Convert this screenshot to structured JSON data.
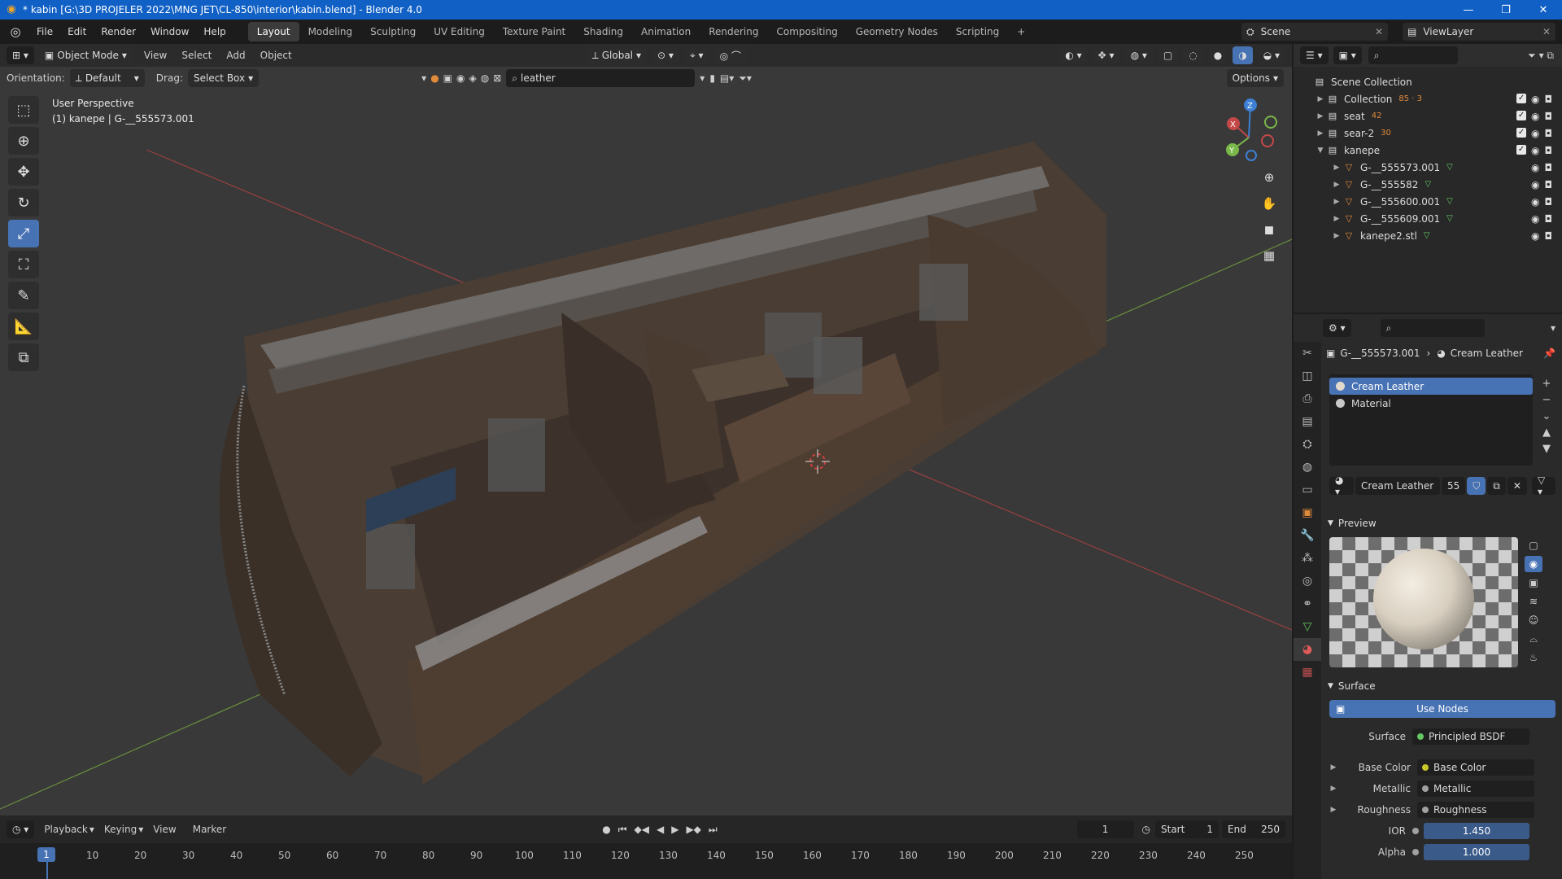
{
  "window": {
    "title": "* kabin [G:\\3D PROJELER 2022\\MNG JET\\CL-850\\interior\\kabin.blend] - Blender 4.0",
    "controls": [
      "—",
      "❐",
      "✕"
    ]
  },
  "menu": {
    "items": [
      "File",
      "Edit",
      "Render",
      "Window",
      "Help"
    ],
    "workspaces": [
      "Layout",
      "Modeling",
      "Sculpting",
      "UV Editing",
      "Texture Paint",
      "Shading",
      "Animation",
      "Rendering",
      "Compositing",
      "Geometry Nodes",
      "Scripting",
      "+"
    ],
    "active_workspace": "Layout",
    "scene": "Scene",
    "view_layer": "ViewLayer"
  },
  "viewport": {
    "mode": "Object Mode",
    "header_menus": [
      "View",
      "Select",
      "Add",
      "Object"
    ],
    "transform": "Global",
    "orientation_label": "Orientation:",
    "orientation_value": "Default",
    "drag_label": "Drag:",
    "drag_value": "Select Box",
    "search_value": "leather",
    "options_label": "Options",
    "info_line1": "User Perspective",
    "info_line2": "(1) kanepe | G-__555573.001",
    "gizmo_axes": {
      "z": "Z",
      "x": "X",
      "y": "Y"
    },
    "colors": {
      "x_axis": "#c44848",
      "y_axis": "#7ab84a",
      "z_axis": "#3d7fd4",
      "active_tool": "#4772b3"
    }
  },
  "timeline": {
    "menus": [
      "Playback",
      "Keying",
      "View",
      "Marker"
    ],
    "current_frame": "1",
    "start_label": "Start",
    "start_value": "1",
    "end_label": "End",
    "end_value": "250",
    "ruler": [
      "1",
      "10",
      "20",
      "30",
      "40",
      "50",
      "60",
      "70",
      "80",
      "90",
      "100",
      "110",
      "120",
      "130",
      "140",
      "150",
      "160",
      "170",
      "180",
      "190",
      "200",
      "210",
      "220",
      "230",
      "240",
      "250"
    ]
  },
  "outliner": {
    "root": "Scene Collection",
    "rows": [
      {
        "name": "Collection",
        "badge": "85 · 3",
        "type": "collection"
      },
      {
        "name": "seat",
        "badge": "42",
        "type": "collection"
      },
      {
        "name": "sear-2",
        "badge": "30",
        "type": "collection"
      },
      {
        "name": "kanepe",
        "badge": "",
        "type": "collection"
      },
      {
        "name": "G-__555573.001",
        "badge": "",
        "type": "mesh"
      },
      {
        "name": "G-__555582",
        "badge": "",
        "type": "mesh"
      },
      {
        "name": "G-__555600.001",
        "badge": "",
        "type": "mesh"
      },
      {
        "name": "G-__555609.001",
        "badge": "",
        "type": "mesh"
      },
      {
        "name": "kanepe2.stl",
        "badge": "",
        "type": "mesh"
      }
    ]
  },
  "properties": {
    "breadcrumb_object": "G-__555573.001",
    "breadcrumb_material": "Cream Leather",
    "slots": [
      "Cream Leather",
      "Material"
    ],
    "material_name": "Cream Leather",
    "material_users": "55",
    "preview_label": "Preview",
    "surface_label": "Surface",
    "use_nodes_label": "Use Nodes",
    "fields": [
      {
        "label": "Surface",
        "value": "Principled BSDF",
        "kind": "node"
      },
      {
        "label": "Base Color",
        "value": "Base Color",
        "kind": "link"
      },
      {
        "label": "Metallic",
        "value": "Metallic",
        "kind": "link"
      },
      {
        "label": "Roughness",
        "value": "Roughness",
        "kind": "link"
      },
      {
        "label": "IOR",
        "value": "1.450",
        "kind": "number"
      },
      {
        "label": "Alpha",
        "value": "1.000",
        "kind": "number"
      }
    ]
  }
}
